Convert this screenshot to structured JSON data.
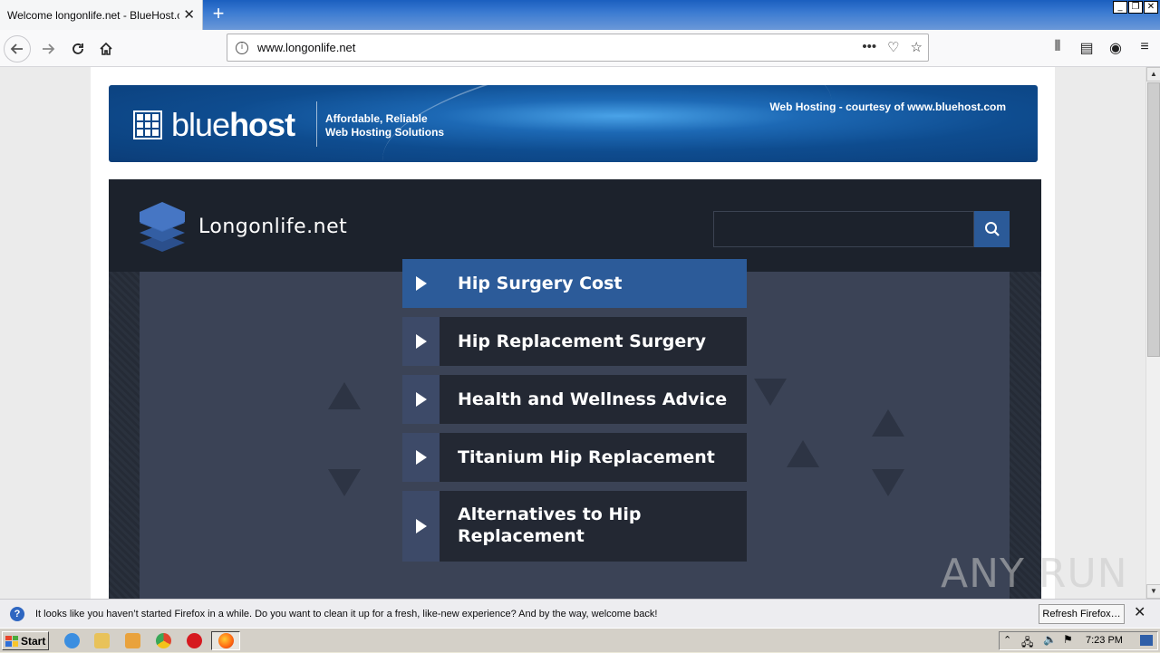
{
  "browser": {
    "tab_title": "Welcome longonlife.net - BlueHost.com",
    "url": "www.longonlife.net"
  },
  "banner": {
    "brand_light": "blue",
    "brand_bold": "host",
    "tagline_line1": "Affordable, Reliable",
    "tagline_line2": "Web Hosting Solutions",
    "courtesy": "Web Hosting - courtesy of www.bluehost.com"
  },
  "site": {
    "title": "Longonlife.net",
    "search_placeholder": "",
    "menu": [
      {
        "label": "Hip Surgery Cost",
        "active": true
      },
      {
        "label": "Hip Replacement Surgery",
        "active": false
      },
      {
        "label": "Health and Wellness Advice",
        "active": false
      },
      {
        "label": "Titanium Hip Replacement",
        "active": false
      },
      {
        "label": "Alternatives to Hip Replacement",
        "active": false
      }
    ]
  },
  "notification": {
    "text": "It looks like you haven’t started Firefox in a while. Do you want to clean it up for a fresh, like-new experience? And by the way, welcome back!",
    "button": "Refresh Firefox…"
  },
  "taskbar": {
    "start": "Start",
    "time": "7:23 PM"
  },
  "watermark": "ANY RUN",
  "colors": {
    "menu_active": "#2c5b99",
    "site_bg": "#1c222c",
    "body_bg": "#3b4356"
  }
}
